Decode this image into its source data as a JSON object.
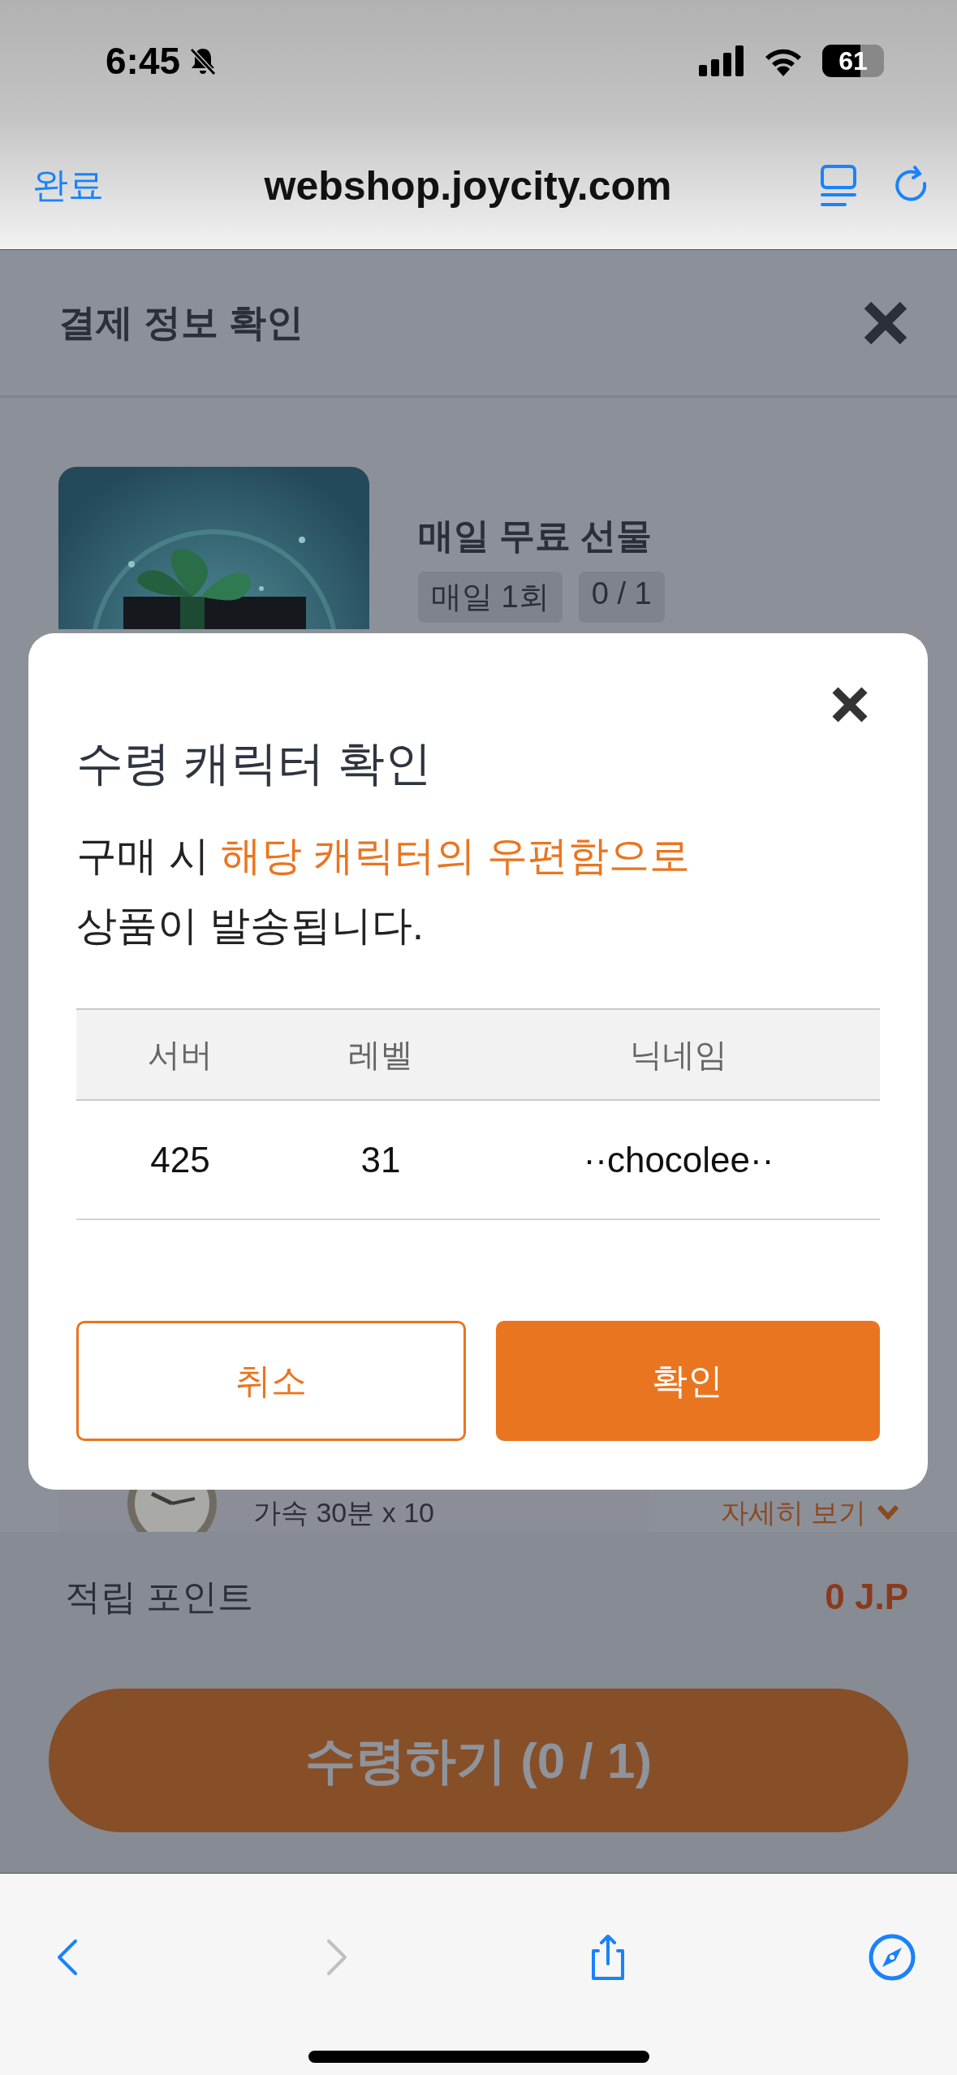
{
  "status_bar": {
    "time": "6:45",
    "battery": "61"
  },
  "browser_bar": {
    "done": "완료",
    "url": "webshop.joycity.com"
  },
  "page": {
    "title": "결제 정보 확인",
    "product": {
      "name": "매일 무료 선물",
      "tags": [
        "매일 1회",
        "0 / 1"
      ]
    },
    "item": {
      "text": "가속 30분 x 10",
      "detail_link": "자세히 보기"
    },
    "points": {
      "label": "적립 포인트",
      "value": "0 J.P"
    },
    "claim_button": "수령하기 (0 / 1)"
  },
  "dialog": {
    "title": "수령 캐릭터 확인",
    "message": [
      [
        {
          "text": "구매 시 ",
          "highlight": false
        },
        {
          "text": "해당 캐릭터의 우편함으로",
          "highlight": true
        }
      ],
      [
        {
          "text": "상품이 발송됩니다.",
          "highlight": false
        }
      ]
    ],
    "columns": [
      "서버",
      "레벨",
      "닉네임"
    ],
    "rows": [
      [
        "425",
        "31",
        "··chocolee··"
      ]
    ],
    "buttons": [
      {
        "label": "취소",
        "kind": "secondary"
      },
      {
        "label": "확인",
        "kind": "primary"
      }
    ]
  },
  "toolbar": [
    {
      "kind": "back",
      "disabled": false
    },
    {
      "kind": "forward",
      "disabled": true
    },
    {
      "kind": "share",
      "disabled": false
    },
    {
      "kind": "compass",
      "disabled": false
    }
  ]
}
